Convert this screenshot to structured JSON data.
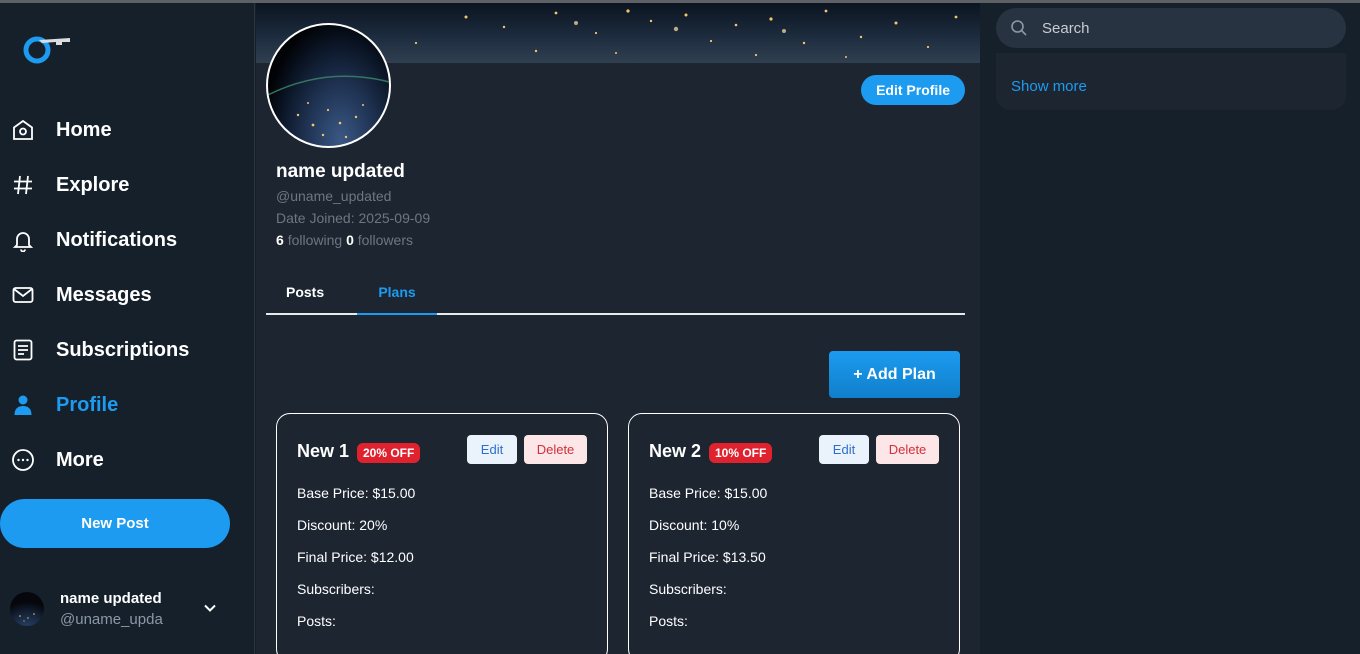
{
  "sidebar": {
    "logo": "app-logo",
    "items": [
      {
        "label": "Home",
        "icon": "home-icon"
      },
      {
        "label": "Explore",
        "icon": "hashtag-icon"
      },
      {
        "label": "Notifications",
        "icon": "bell-icon"
      },
      {
        "label": "Messages",
        "icon": "mail-icon"
      },
      {
        "label": "Subscriptions",
        "icon": "document-icon"
      },
      {
        "label": "Profile",
        "icon": "person-icon",
        "active": true
      },
      {
        "label": "More",
        "icon": "more-circle-icon"
      }
    ],
    "new_post_label": "New Post",
    "account": {
      "name": "name updated",
      "handle": "@uname_upda"
    }
  },
  "profile": {
    "edit_label": "Edit Profile",
    "name": "name updated",
    "handle": "@uname_updated",
    "joined": "Date Joined: 2025-09-09",
    "following_count": "6",
    "following_label": "following",
    "followers_count": "0",
    "followers_label": "followers"
  },
  "tabs": [
    {
      "label": "Posts",
      "active": false
    },
    {
      "label": "Plans",
      "active": true
    }
  ],
  "plans": {
    "add_label": "+ Add Plan",
    "edit_label": "Edit",
    "delete_label": "Delete",
    "items": [
      {
        "title": "New 1",
        "badge": "20% OFF",
        "base_price": "Base Price: $15.00",
        "discount": "Discount: 20%",
        "final_price": "Final Price: $12.00",
        "subscribers": "Subscribers:",
        "posts": "Posts:"
      },
      {
        "title": "New 2",
        "badge": "10% OFF",
        "base_price": "Base Price: $15.00",
        "discount": "Discount: 10%",
        "final_price": "Final Price: $13.50",
        "subscribers": "Subscribers:",
        "posts": "Posts:"
      }
    ]
  },
  "right": {
    "search_placeholder": "Search",
    "show_more": "Show more"
  },
  "colors": {
    "accent": "#1d9bf0",
    "background": "#15202b",
    "panel": "#1c2530",
    "badge_red": "#e0222f"
  }
}
